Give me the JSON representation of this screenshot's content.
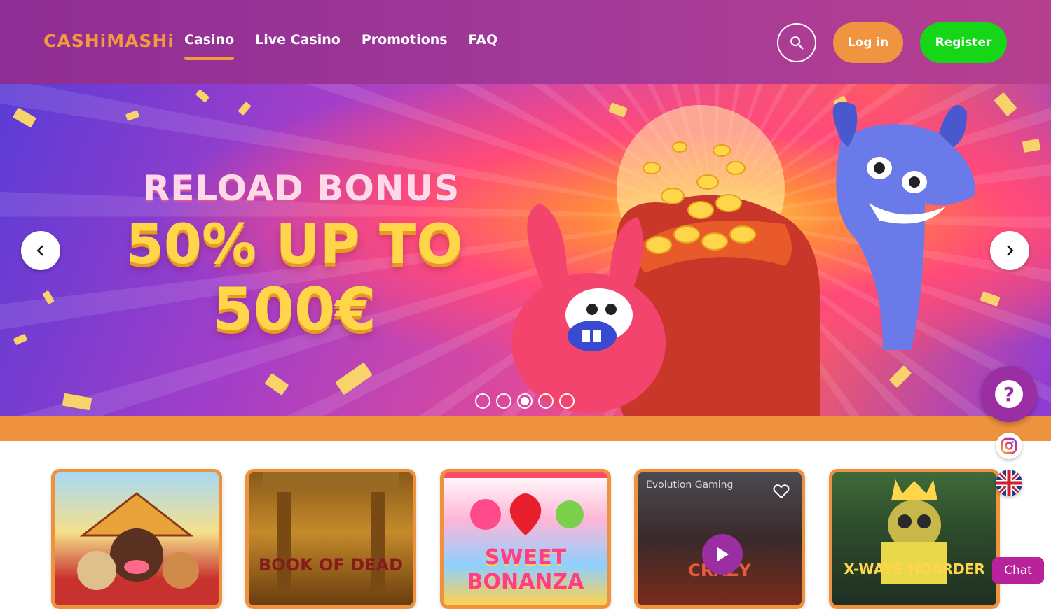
{
  "brand": {
    "logo_text": "CASHiMASHi",
    "accent": "#f39a3d",
    "primary": "#9b2ea3"
  },
  "nav": {
    "items": [
      {
        "label": "Casino",
        "active": true
      },
      {
        "label": "Live Casino",
        "active": false
      },
      {
        "label": "Promotions",
        "active": false
      },
      {
        "label": "FAQ",
        "active": false
      }
    ]
  },
  "header": {
    "search_icon": "search-icon",
    "login_label": "Log in",
    "register_label": "Register"
  },
  "banner": {
    "title": "RELOAD BONUS",
    "line1": "50% UP TO",
    "line2": "500€",
    "slides_count": 5,
    "active_slide": 3
  },
  "widgets": {
    "help_symbol": "?",
    "chat_label": "Chat"
  },
  "games": [
    {
      "name": "",
      "label": ""
    },
    {
      "name": "",
      "label": "BOOK OF DEAD"
    },
    {
      "name": "",
      "label": "SWEET BONANZA"
    },
    {
      "name": "",
      "label": "CRAZY",
      "provider": "Evolution Gaming"
    },
    {
      "name": "",
      "label": "X-WAYS HOARDER"
    }
  ]
}
